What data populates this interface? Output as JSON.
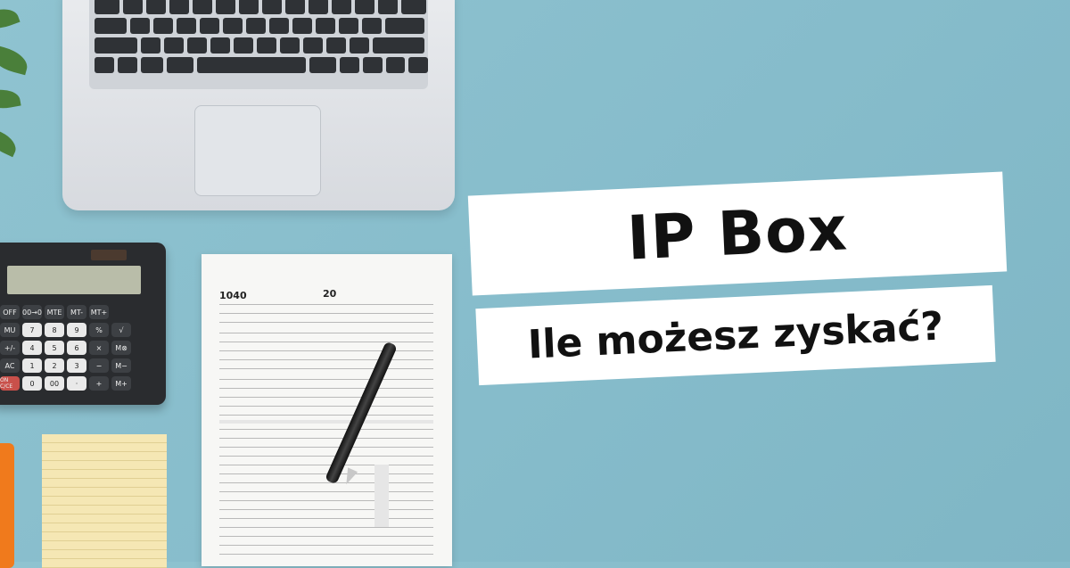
{
  "banner": {
    "title": "IP Box",
    "subtitle": "Ile możesz zyskać?"
  },
  "form": {
    "number": "1040",
    "year": "20"
  },
  "calculator": {
    "keys": [
      "OFF",
      "00→0",
      "MTE",
      "MT-",
      "MT+",
      "",
      "",
      "MU",
      "7",
      "8",
      "9",
      "%",
      "√",
      "",
      "+/-",
      "4",
      "5",
      "6",
      "×",
      "M⊗",
      "",
      "AC",
      "1",
      "2",
      "3",
      "−",
      "M−",
      "",
      "ON C/CE",
      "0",
      "00",
      "·",
      "+",
      "M+",
      ""
    ]
  },
  "colors": {
    "background": "#8fc3d0",
    "banner": "#ffffff",
    "text": "#111111"
  }
}
